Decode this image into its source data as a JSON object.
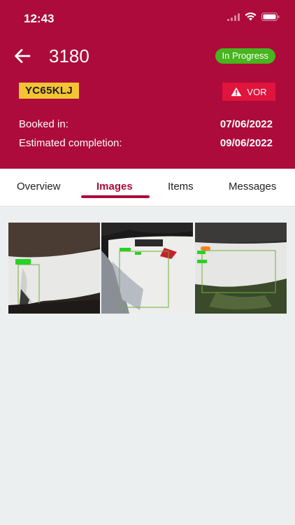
{
  "status_bar": {
    "time": "12:43"
  },
  "job": {
    "number": "3180",
    "status": "In Progress",
    "registration": "YC65KLJ",
    "vor_label": "VOR",
    "booked_in_label": "Booked in:",
    "booked_in_value": "07/06/2022",
    "estimated_label": "Estimated completion:",
    "estimated_value": "09/06/2022"
  },
  "tabs": [
    {
      "label": "Overview"
    },
    {
      "label": "Images",
      "active": true
    },
    {
      "label": "Items"
    },
    {
      "label": "Messages"
    }
  ],
  "images": [
    {
      "name": "damage-photo-1"
    },
    {
      "name": "damage-photo-2"
    },
    {
      "name": "damage-photo-3"
    }
  ],
  "colors": {
    "brand": "#ad0b3c",
    "status_in_progress": "#46b51e",
    "plate": "#f4c432",
    "vor": "#e0143c",
    "background": "#eceff0"
  }
}
